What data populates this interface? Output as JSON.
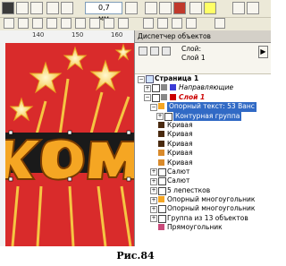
{
  "toolbar": {
    "outline_width": "0,7 мм"
  },
  "ruler": {
    "ticks": [
      "140",
      "150",
      "160"
    ]
  },
  "docker": {
    "title": "Диспетчер объектов",
    "layer_label": "Слой:",
    "layer_value": "Слой 1",
    "arrow": "▶"
  },
  "tree": {
    "page": "Страница 1",
    "guides": "Направляющие",
    "layer1": "Слой 1",
    "artistic_text": "Опорный текст: 53 Ванс",
    "contour_group": "Контурная группа",
    "curve1": "Кривая",
    "curve2": "Кривая",
    "curve3": "Кривая",
    "curve4": "Кривая",
    "curve5": "Кривая",
    "salute1": "Салют",
    "salute2": "Салют",
    "petals": "5 лепестков",
    "polygon1": "Опорный многоугольник",
    "polygon2": "Опорный многоугольник",
    "group13": "Группа из 13 объектов",
    "rectangle": "Прямоугольник"
  },
  "canvas": {
    "text_fragment": "КОМ"
  },
  "caption": "Рис.84",
  "colors": {
    "background_red": "#d92b2b",
    "star_yellow": "#f5c542",
    "selection_blue": "#316ac5",
    "layer_red": "#cc0000"
  }
}
